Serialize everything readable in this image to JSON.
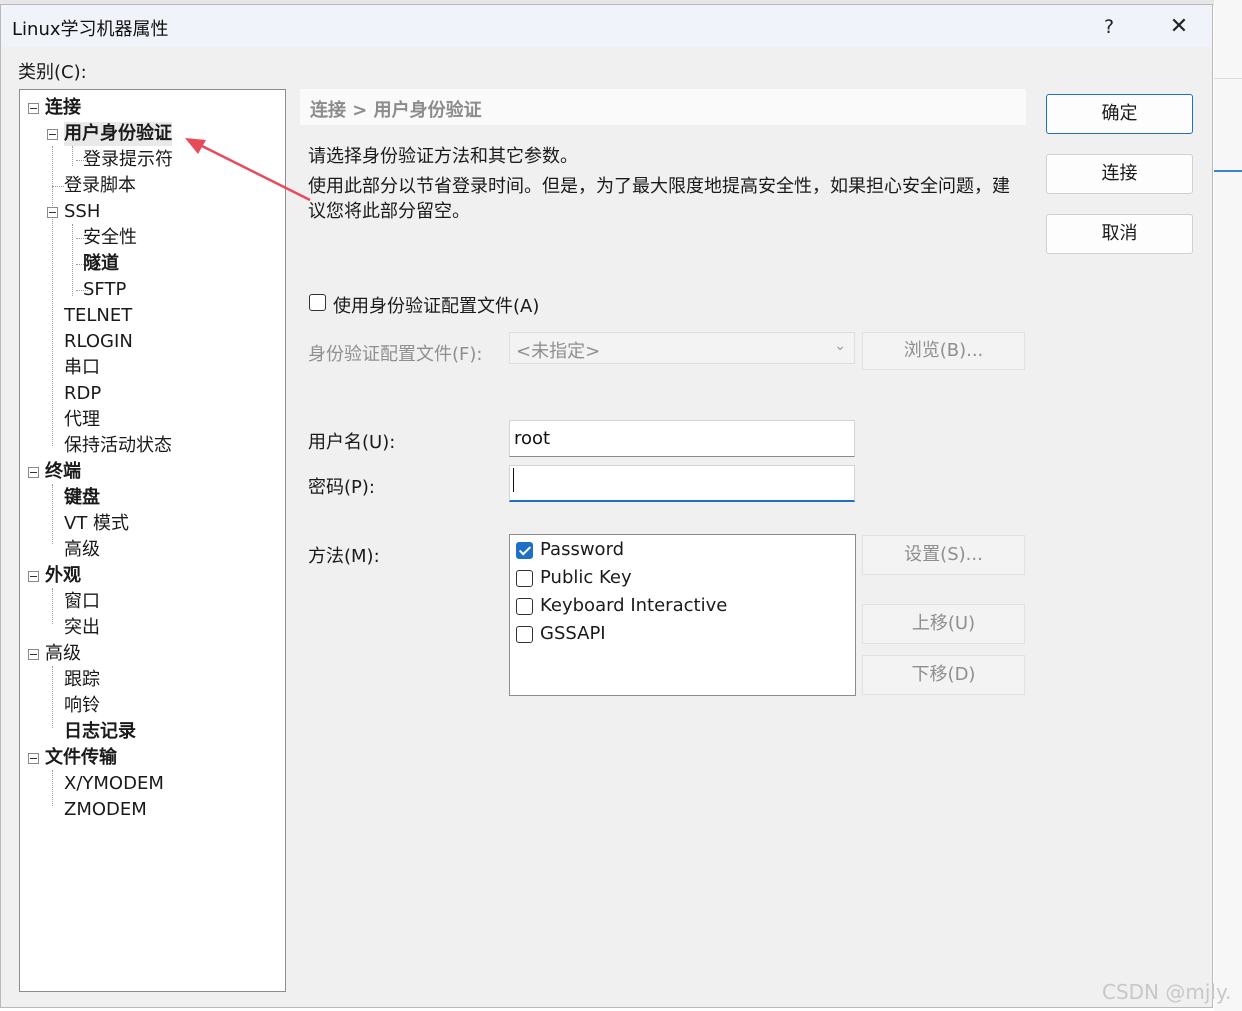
{
  "window": {
    "title": "Linux学习机器属性",
    "help_label": "?",
    "close_label": "✕"
  },
  "category_label": "类别(C):",
  "tree": {
    "items": [
      {
        "label": "连接"
      },
      {
        "label": "用户身份验证"
      },
      {
        "label": "登录提示符"
      },
      {
        "label": "登录脚本"
      },
      {
        "label": "SSH"
      },
      {
        "label": "安全性"
      },
      {
        "label": "隧道"
      },
      {
        "label": "SFTP"
      },
      {
        "label": "TELNET"
      },
      {
        "label": "RLOGIN"
      },
      {
        "label": "串口"
      },
      {
        "label": "RDP"
      },
      {
        "label": "代理"
      },
      {
        "label": "保持活动状态"
      },
      {
        "label": "终端"
      },
      {
        "label": "键盘"
      },
      {
        "label": "VT 模式"
      },
      {
        "label": "高级"
      },
      {
        "label": "外观"
      },
      {
        "label": "窗口"
      },
      {
        "label": "突出"
      },
      {
        "label": "高级"
      },
      {
        "label": "跟踪"
      },
      {
        "label": "响铃"
      },
      {
        "label": "日志记录"
      },
      {
        "label": "文件传输"
      },
      {
        "label": "X/YMODEM"
      },
      {
        "label": "ZMODEM"
      }
    ]
  },
  "breadcrumb": "连接 > 用户身份验证",
  "description": {
    "line1": "请选择身份验证方法和其它参数。",
    "line2": "使用此部分以节省登录时间。但是，为了最大限度地提高安全性，如果担心安全问题，建议您将此部分留空。"
  },
  "profile": {
    "checkbox_label": "使用身份验证配置文件(A)",
    "checked": false,
    "field_label": "身份验证配置文件(F):",
    "selected_value": "<未指定>",
    "browse_label": "浏览(B)..."
  },
  "username": {
    "label": "用户名(U):",
    "value": "root"
  },
  "password": {
    "label": "密码(P):",
    "value": ""
  },
  "method": {
    "label": "方法(M):",
    "options": [
      {
        "label": "Password",
        "checked": true
      },
      {
        "label": "Public Key",
        "checked": false
      },
      {
        "label": "Keyboard Interactive",
        "checked": false
      },
      {
        "label": "GSSAPI",
        "checked": false
      }
    ],
    "settings_label": "设置(S)...",
    "move_up_label": "上移(U)",
    "move_down_label": "下移(D)"
  },
  "buttons": {
    "ok_label": "确定",
    "connect_label": "连接",
    "cancel_label": "取消"
  },
  "annotation_color": "#e94a5a",
  "accent_color": "#1f6fc5",
  "watermark": "CSDN @mjly."
}
